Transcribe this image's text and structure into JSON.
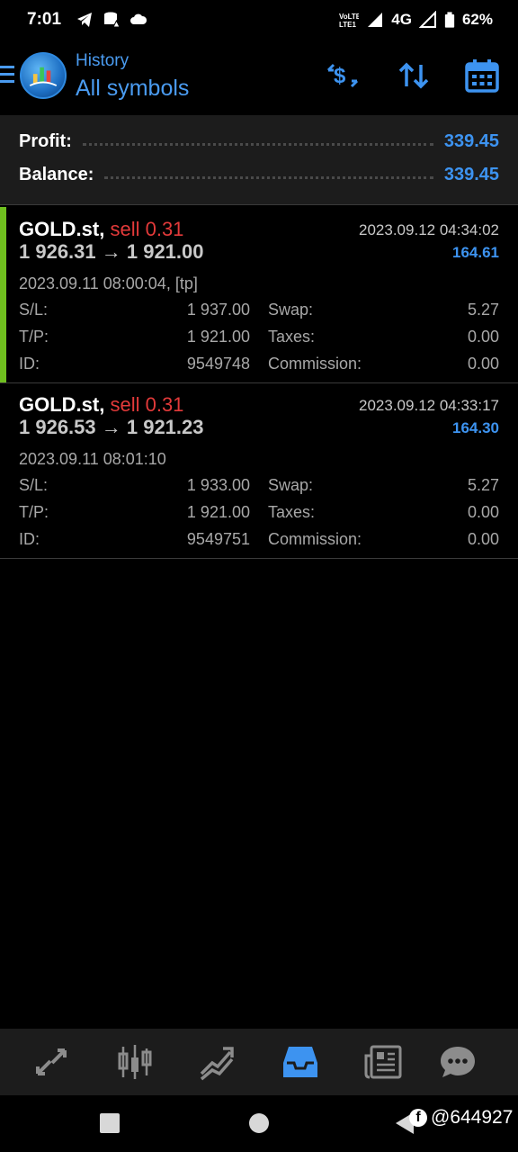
{
  "status_bar": {
    "time": "7:01",
    "network": "4G",
    "battery": "62%"
  },
  "header": {
    "subtitle": "History",
    "title": "All symbols"
  },
  "summary": {
    "profit_label": "Profit:",
    "profit_value": "339.45",
    "balance_label": "Balance:",
    "balance_value": "339.45"
  },
  "deals": [
    {
      "symbol": "GOLD.st,",
      "side": "sell 0.31",
      "prices": "1 926.31 → 1 921.00",
      "close_time": "2023.09.12 04:34:02",
      "profit": "164.61",
      "open_time": "2023.09.11 08:00:04, [tp]",
      "sl_label": "S/L:",
      "sl_value": "1 937.00",
      "tp_label": "T/P:",
      "tp_value": "1 921.00",
      "id_label": "ID:",
      "id_value": "9549748",
      "swap_label": "Swap:",
      "swap_value": "5.27",
      "taxes_label": "Taxes:",
      "taxes_value": "0.00",
      "commission_label": "Commission:",
      "commission_value": "0.00"
    },
    {
      "symbol": "GOLD.st,",
      "side": "sell 0.31",
      "prices": "1 926.53 → 1 921.23",
      "close_time": "2023.09.12 04:33:17",
      "profit": "164.30",
      "open_time": "2023.09.11 08:01:10",
      "sl_label": "S/L:",
      "sl_value": "1 933.00",
      "tp_label": "T/P:",
      "tp_value": "1 921.00",
      "id_label": "ID:",
      "id_value": "9549751",
      "swap_label": "Swap:",
      "swap_value": "5.27",
      "taxes_label": "Taxes:",
      "taxes_value": "0.00",
      "commission_label": "Commission:",
      "commission_value": "0.00"
    }
  ],
  "tabbar": {
    "active_tab": "history",
    "tabs": [
      "quotes-icon",
      "chart-icon",
      "trade-icon",
      "history-icon",
      "news-icon",
      "chat-icon"
    ]
  },
  "watermark": "@644927",
  "colors": {
    "accent": "#3d93f0",
    "sell": "#e33a3a",
    "deal_marker": "#6fbf1f"
  }
}
